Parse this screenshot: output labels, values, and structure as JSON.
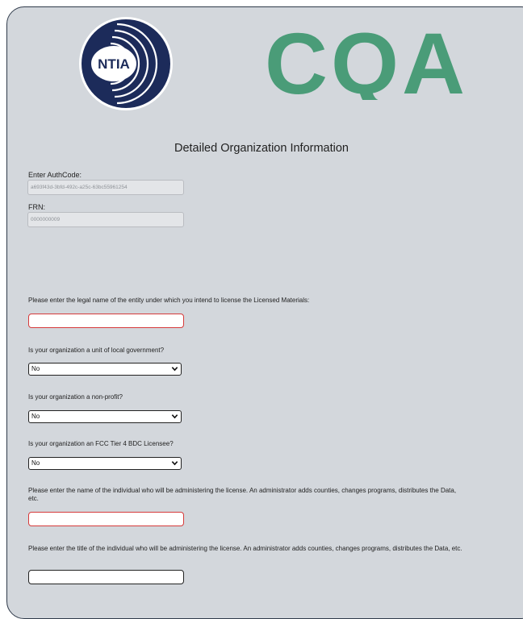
{
  "logos": {
    "left": "NTIA",
    "right": "CQA",
    "left_color": "#1c2b5a",
    "right_color": "#4a9c78"
  },
  "page_title": "Detailed Organization Information",
  "authcode": {
    "label": "Enter AuthCode:",
    "value": "a693f43d-3bfd-492c-a25c-63bc55961254"
  },
  "frn": {
    "label": "FRN:",
    "value": "0000000009"
  },
  "questions": {
    "legal_name": "Please enter the legal name of the entity under which you intend to license the Licensed Materials:",
    "local_gov": "Is your organization a unit of local government?",
    "non_profit": "Is your organization a non-profit?",
    "fcc_tier4": "Is your organization an FCC Tier 4 BDC Licensee?",
    "admin_name": "Please enter the name of the individual who will be administering the license. An administrator adds counties, changes programs, distributes the Data, etc.",
    "admin_title": "Please enter the title of the individual who will be administering the license. An administrator adds counties, changes programs, distributes the Data, etc."
  },
  "selects": {
    "local_gov": "No",
    "non_profit": "No",
    "fcc_tier4": "No"
  },
  "colors": {
    "error_border": "#d63a3a",
    "panel_bg": "#d3d7dc"
  }
}
